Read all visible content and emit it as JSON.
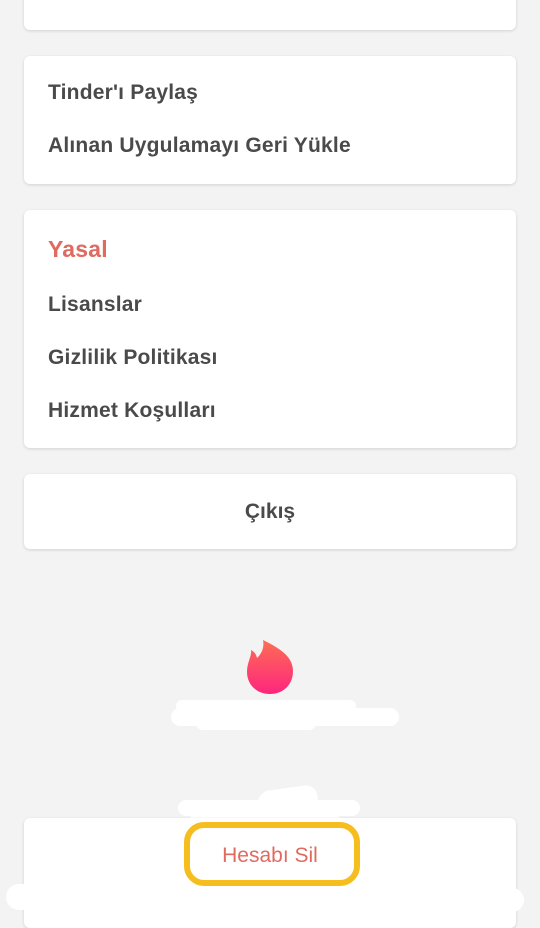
{
  "share_section": {
    "items": [
      {
        "label": "Tinder'ı Paylaş"
      },
      {
        "label": "Alınan Uygulamayı Geri Yükle"
      }
    ]
  },
  "legal_section": {
    "title": "Yasal",
    "items": [
      {
        "label": "Lisanslar"
      },
      {
        "label": "Gizlilik Politikası"
      },
      {
        "label": "Hizmet Koşulları"
      }
    ]
  },
  "logout": {
    "label": "Çıkış"
  },
  "delete_account": {
    "label": "Hesabı Sil"
  },
  "branding": {
    "logo_icon": "tinder-flame-icon"
  },
  "colors": {
    "accent": "#e06a5f",
    "text": "#4a4a4a",
    "background": "#f3f3f3",
    "highlight": "#f5bd1e",
    "flame_top": "#fd6e54",
    "flame_bottom": "#fd267d"
  }
}
